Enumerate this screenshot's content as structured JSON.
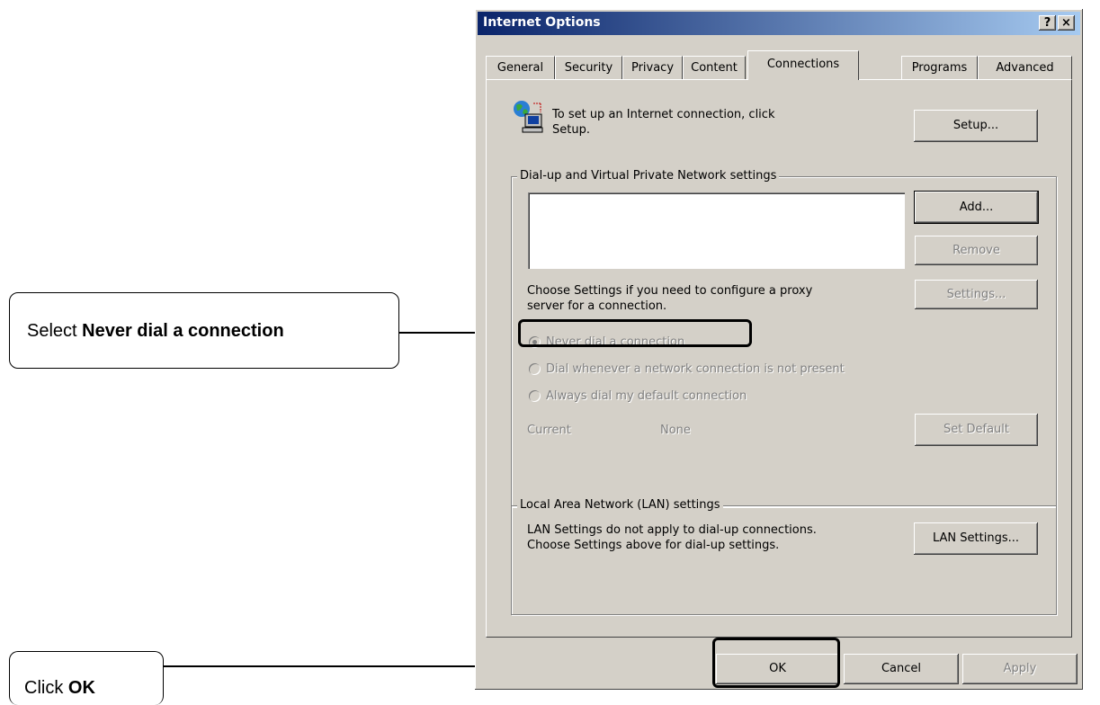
{
  "window": {
    "title": "Internet Options",
    "help_glyph": "?",
    "close_glyph": "×"
  },
  "tabs": [
    {
      "label": "General"
    },
    {
      "label": "Security"
    },
    {
      "label": "Privacy"
    },
    {
      "label": "Content"
    },
    {
      "label": "Connections",
      "active": true
    },
    {
      "label": "Programs"
    },
    {
      "label": "Advanced"
    }
  ],
  "setup": {
    "icon": "network-computer-icon",
    "line1": "To set up an Internet connection, click",
    "line2": "Setup.",
    "button": "Setup..."
  },
  "dialup": {
    "legend": "Dial-up and Virtual Private Network settings",
    "add": "Add...",
    "remove": "Remove",
    "settings": "Settings...",
    "proxy_line1": "Choose Settings if you need to configure a proxy",
    "proxy_line2": "server for a connection.",
    "radio_never": "Never dial a connection",
    "radio_whenever": "Dial whenever a network connection is not present",
    "radio_always": "Always dial my default connection",
    "current_label": "Current",
    "current_value": "None",
    "set_default": "Set Default"
  },
  "lan": {
    "legend": "Local Area Network (LAN) settings",
    "line1": "LAN Settings do not apply to dial-up connections.",
    "line2": "Choose Settings above for dial-up settings.",
    "button": "LAN Settings..."
  },
  "footer": {
    "ok": "OK",
    "cancel": "Cancel",
    "apply": "Apply"
  },
  "callouts": {
    "select_prefix": "Select ",
    "select_bold": "Never dial a connection",
    "click_prefix": "Click ",
    "click_bold": "OK"
  }
}
